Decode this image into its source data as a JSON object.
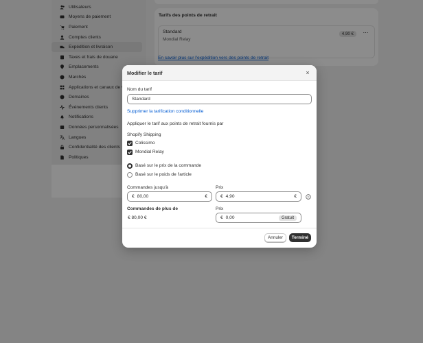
{
  "sidebar": {
    "items": [
      {
        "label": "Utilisateurs",
        "icon": "users-icon"
      },
      {
        "label": "Moyens de paiement",
        "icon": "payment-icon"
      },
      {
        "label": "Paiement",
        "icon": "cart-icon"
      },
      {
        "label": "Comptes clients",
        "icon": "person-icon"
      },
      {
        "label": "Expédition et livraison",
        "icon": "truck-icon"
      },
      {
        "label": "Taxes et frais de douane",
        "icon": "tax-icon"
      },
      {
        "label": "Emplacements",
        "icon": "location-icon"
      },
      {
        "label": "Marchés",
        "icon": "globe-icon"
      },
      {
        "label": "Applications et canaux de vente",
        "icon": "apps-icon"
      },
      {
        "label": "Domaines",
        "icon": "domain-icon"
      },
      {
        "label": "Événements clients",
        "icon": "events-icon"
      },
      {
        "label": "Notifications",
        "icon": "bell-icon"
      },
      {
        "label": "Données personnalisées",
        "icon": "data-icon"
      },
      {
        "label": "Langues",
        "icon": "language-icon"
      },
      {
        "label": "Confidentialité des clients",
        "icon": "lock-icon"
      },
      {
        "label": "Politiques",
        "icon": "document-icon"
      }
    ]
  },
  "pickup_card": {
    "title": "Tarifs des points de retrait",
    "rate_name": "Standard",
    "rate_carrier": "Mondial Relay",
    "rate_price": "4,90 €",
    "more_label": "⋯",
    "learn_link": "En savoir plus sur l'expédition vers des points de retrait"
  },
  "modal": {
    "title": "Modifier le tarif",
    "close_label": "×",
    "rate_name_label": "Nom du tarif",
    "rate_name_value": "Standard",
    "remove_conditional_link": "Supprimer la tarification conditionnelle",
    "apply_label": "Appliquer le tarif aux points de retrait fournis par",
    "shipping_group_label": "Shopify Shipping",
    "carriers": [
      {
        "label": "Colissimo",
        "checked": true
      },
      {
        "label": "Mondial Relay",
        "checked": true
      }
    ],
    "conditions": [
      {
        "label": "Basé sur le prix de la commande",
        "selected": true
      },
      {
        "label": "Basé sur le poids de l'article",
        "selected": false
      }
    ],
    "orders_up_to_label": "Commandes jusqu'à",
    "orders_up_to_prefix": "€",
    "orders_up_to_value": "80,00",
    "orders_up_to_suffix": "€",
    "price_label": "Prix",
    "price_prefix": "€",
    "price_value": "4,90",
    "price_suffix": "€",
    "orders_over_label": "Commandes de plus de",
    "orders_over_value": "€ 80,00 €",
    "price2_label": "Prix",
    "price2_prefix": "€",
    "price2_value": "0,00",
    "free_badge": "Gratuit",
    "cancel_button": "Annuler",
    "done_button": "Terminé"
  }
}
